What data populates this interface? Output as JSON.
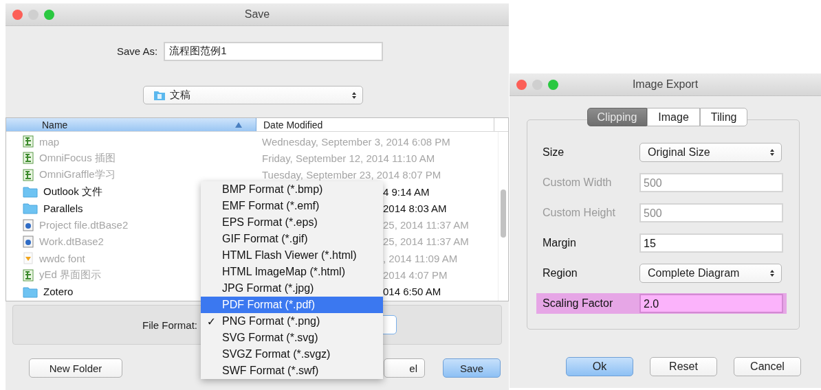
{
  "save_window": {
    "title": "Save",
    "save_as_label": "Save As:",
    "save_as_value": "流程图范例1",
    "folder": "文稿",
    "columns": [
      {
        "label": "Name",
        "sorted": true
      },
      {
        "label": "Date Modified",
        "sorted": false
      }
    ],
    "rows": [
      {
        "kind": "graffle",
        "name": "map",
        "date": "Wednesday, September 3, 2014 6:08 PM",
        "disabled": true,
        "covered": false
      },
      {
        "kind": "graffle",
        "name": "OmniFocus 插图",
        "date": "Friday, September 12, 2014 11:10 AM",
        "disabled": true,
        "covered": false
      },
      {
        "kind": "graffle",
        "name": "OmniGraffle学习",
        "date": "Tuesday, September 23, 2014 8:07 PM",
        "disabled": true,
        "covered": false
      },
      {
        "kind": "folder",
        "name": "Outlook 文件",
        "date": "4 9:14 AM",
        "disabled": false,
        "covered": true
      },
      {
        "kind": "folder",
        "name": "Parallels",
        "date": "2014 8:03 AM",
        "disabled": false,
        "covered": true
      },
      {
        "kind": "database",
        "name": "Project file.dtBase2",
        "date": "25, 2014 11:37 AM",
        "disabled": true,
        "covered": true
      },
      {
        "kind": "database",
        "name": "Work.dtBase2",
        "date": "25, 2014 11:37 AM",
        "disabled": true,
        "covered": true
      },
      {
        "kind": "font",
        "name": "wwdc font",
        "date": ", 2014 11:09 AM",
        "disabled": true,
        "covered": true
      },
      {
        "kind": "graffle",
        "name": "yEd 界面图示",
        "date": "2014 4:07 PM",
        "disabled": true,
        "covered": true
      },
      {
        "kind": "folder",
        "name": "Zotero",
        "date": "014 6:50 AM",
        "disabled": false,
        "covered": true
      }
    ],
    "file_format_label": "File Format:",
    "buttons": [
      {
        "label": "New Folder",
        "kind": "left",
        "default": false
      },
      {
        "label": "el",
        "kind": "cancel",
        "default": false
      },
      {
        "label": "Save",
        "kind": "ok",
        "default": true
      }
    ],
    "check_mark": "✓",
    "format_menu": [
      {
        "label": "BMP Format (*.bmp)",
        "selected": false,
        "checked": false
      },
      {
        "label": "EMF Format (*.emf)",
        "selected": false,
        "checked": false
      },
      {
        "label": "EPS Format (*.eps)",
        "selected": false,
        "checked": false
      },
      {
        "label": "GIF Format (*.gif)",
        "selected": false,
        "checked": false
      },
      {
        "label": "HTML Flash Viewer (*.html)",
        "selected": false,
        "checked": false
      },
      {
        "label": "HTML ImageMap (*.html)",
        "selected": false,
        "checked": false
      },
      {
        "label": "JPG Format (*.jpg)",
        "selected": false,
        "checked": false
      },
      {
        "label": "PDF Format (*.pdf)",
        "selected": true,
        "checked": false
      },
      {
        "label": "PNG Format (*.png)",
        "selected": false,
        "checked": true
      },
      {
        "label": "SVG Format (*.svg)",
        "selected": false,
        "checked": false
      },
      {
        "label": "SVGZ Format (*.svgz)",
        "selected": false,
        "checked": false
      },
      {
        "label": "SWF Format (*.swf)",
        "selected": false,
        "checked": false
      }
    ]
  },
  "export_window": {
    "title": "Image Export",
    "tabs": [
      {
        "label": "Clipping",
        "selected": true
      },
      {
        "label": "Image",
        "selected": false
      },
      {
        "label": "Tiling",
        "selected": false
      }
    ],
    "fields": [
      {
        "kind": "combo",
        "label": "Size",
        "value": "Original Size",
        "disabled": false,
        "highlighted": false
      },
      {
        "kind": "text",
        "label": "Custom Width",
        "value": "500",
        "disabled": true,
        "highlighted": false
      },
      {
        "kind": "text",
        "label": "Custom Height",
        "value": "500",
        "disabled": true,
        "highlighted": false
      },
      {
        "kind": "text",
        "label": "Margin",
        "value": "15",
        "disabled": false,
        "highlighted": false
      },
      {
        "kind": "combo",
        "label": "Region",
        "value": "Complete Diagram",
        "disabled": false,
        "highlighted": false
      },
      {
        "kind": "text",
        "label": "Scaling Factor",
        "value": "2.0",
        "disabled": false,
        "highlighted": true
      }
    ],
    "buttons": [
      {
        "label": "Ok",
        "default": true
      },
      {
        "label": "Reset",
        "default": false
      },
      {
        "label": "Cancel",
        "default": false
      }
    ]
  }
}
